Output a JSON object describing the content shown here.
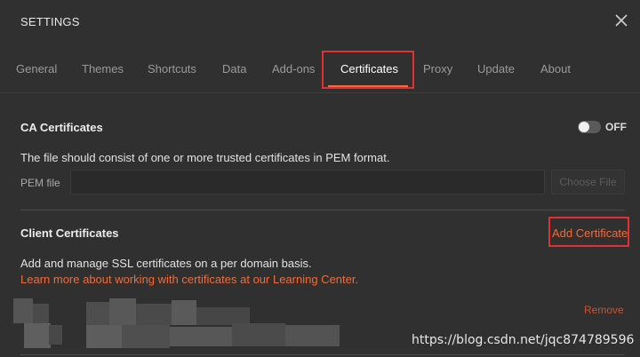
{
  "window": {
    "title": "SETTINGS",
    "close_icon": "close-icon"
  },
  "tabs": [
    {
      "label": "General"
    },
    {
      "label": "Themes"
    },
    {
      "label": "Shortcuts"
    },
    {
      "label": "Data"
    },
    {
      "label": "Add-ons"
    },
    {
      "label": "Certificates",
      "active": true
    },
    {
      "label": "Proxy"
    },
    {
      "label": "Update"
    },
    {
      "label": "About"
    }
  ],
  "ca": {
    "title": "CA Certificates",
    "toggle_label": "OFF",
    "toggle_on": false,
    "description": "The file should consist of one or more trusted certificates in PEM format.",
    "pem_label": "PEM file",
    "pem_value": "",
    "choose_file_label": "Choose File"
  },
  "client": {
    "title": "Client Certificates",
    "add_label": "Add Certificate",
    "description": "Add and manage SSL certificates on a per domain basis.",
    "learn_more": "Learn more about working with certificates at our Learning Center.",
    "remove_label": "Remove"
  },
  "watermark": "https://blog.csdn.net/jqc874789596",
  "colors": {
    "accent": "#f26b3a",
    "highlight": "#e03030",
    "background": "#303030"
  }
}
